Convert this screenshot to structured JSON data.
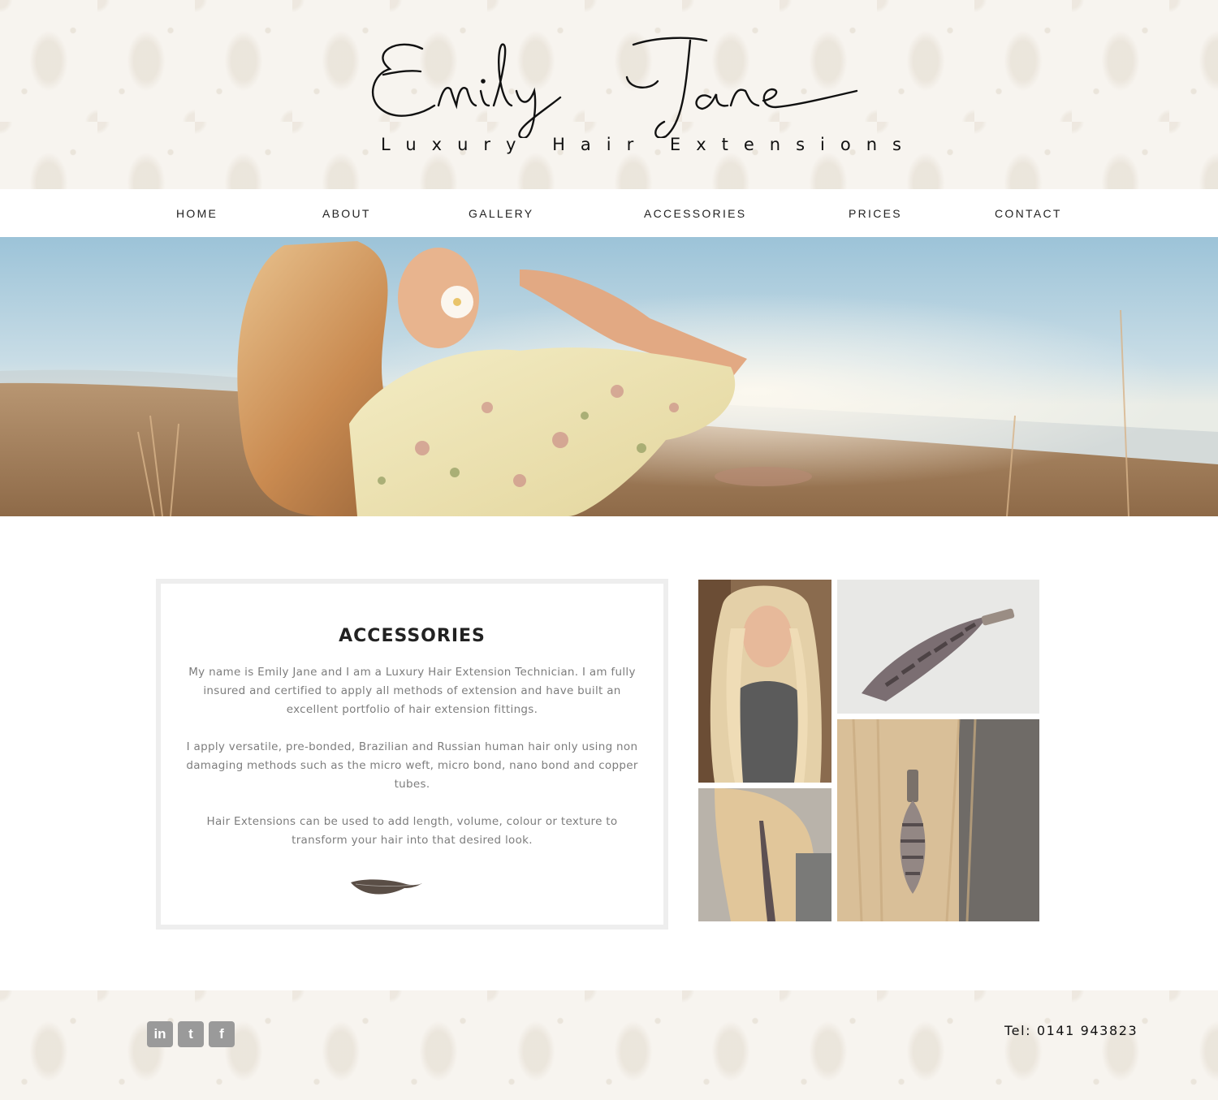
{
  "header": {
    "logo_script": "Emily Jane",
    "tagline": "Luxury Hair Extensions"
  },
  "nav": {
    "items": [
      {
        "label": "HOME"
      },
      {
        "label": "ABOUT"
      },
      {
        "label": "GALLERY"
      },
      {
        "label": "ACCESSORIES"
      },
      {
        "label": "PRICES"
      },
      {
        "label": "CONTACT"
      }
    ]
  },
  "hero": {
    "icon": "hero-banner-photo"
  },
  "content": {
    "title": "ACCESSORIES",
    "paragraphs": [
      "My name is Emily Jane and I am a Luxury Hair Extension Technician. I am fully insured and certified to apply all methods of extension and have built an excellent portfolio of hair extension fittings.",
      "I apply versatile, pre-bonded, Brazilian and Russian human hair only using non damaging methods such as the micro weft, micro bond, nano bond and copper tubes.",
      "Hair Extensions can be used to add length, volume, colour or texture to transform your hair into that desired look."
    ],
    "divider_icon": "feather-icon"
  },
  "gallery": {
    "photos": [
      "blonde-long-hair-photo",
      "feather-accessory-photo",
      "side-hair-feather-photo",
      "hair-bead-feather-photo"
    ]
  },
  "footer": {
    "social": [
      {
        "icon": "linkedin-icon",
        "glyph": "in"
      },
      {
        "icon": "twitter-icon",
        "glyph": "t"
      },
      {
        "icon": "facebook-icon",
        "glyph": "f"
      }
    ],
    "phone": "Tel: 0141 943823"
  },
  "colors": {
    "accent_text": "#222222",
    "body_text": "#7d7d7d",
    "card_border": "#eeeeee",
    "social_bg": "#9a9a9a"
  }
}
